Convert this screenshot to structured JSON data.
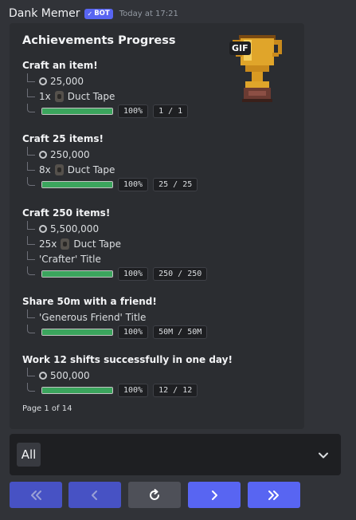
{
  "message": {
    "username": "Dank Memer",
    "bot_badge": "BOT",
    "timestamp": "Today at 17:21"
  },
  "embed": {
    "title": "Achievements Progress",
    "gif_badge": "GIF",
    "footer": "Page 1 of 14",
    "achievements": [
      {
        "title": "Craft an item!",
        "rewards": [
          {
            "icon": "coin-icon",
            "text": "25,000"
          },
          {
            "qty": "1x",
            "icon": "duct-tape-icon",
            "text": "Duct Tape"
          }
        ],
        "progress_fraction": 1.0,
        "percent": "100%",
        "count": "1 / 1"
      },
      {
        "title": "Craft 25 items!",
        "rewards": [
          {
            "icon": "coin-icon",
            "text": "250,000"
          },
          {
            "qty": "8x",
            "icon": "duct-tape-icon",
            "text": "Duct Tape"
          }
        ],
        "progress_fraction": 1.0,
        "percent": "100%",
        "count": "25 / 25"
      },
      {
        "title": "Craft 250 items!",
        "rewards": [
          {
            "icon": "coin-icon",
            "text": "5,500,000"
          },
          {
            "qty": "25x",
            "icon": "duct-tape-icon",
            "text": "Duct Tape"
          },
          {
            "text": "'Crafter' Title"
          }
        ],
        "progress_fraction": 1.0,
        "percent": "100%",
        "count": "250 / 250"
      },
      {
        "title": "Share 50m with a friend!",
        "rewards": [
          {
            "text": "'Generous Friend' Title"
          }
        ],
        "progress_fraction": 1.0,
        "percent": "100%",
        "count": "50M / 50M"
      },
      {
        "title": "Work 12 shifts successfully in one day!",
        "rewards": [
          {
            "icon": "coin-icon",
            "text": "500,000"
          }
        ],
        "progress_fraction": 1.0,
        "percent": "100%",
        "count": "12 / 12"
      }
    ]
  },
  "select_menu": {
    "value": "All",
    "icon": "chevron-down-icon"
  },
  "buttons": [
    {
      "name": "first-page-button",
      "icon": "double-chevron-left-icon",
      "color": "#4752c4"
    },
    {
      "name": "prev-page-button",
      "icon": "chevron-left-icon",
      "color": "#4752c4"
    },
    {
      "name": "refresh-button",
      "icon": "refresh-icon",
      "color": "#4e5058"
    },
    {
      "name": "next-page-button",
      "icon": "chevron-right-icon",
      "color": "#5865f2"
    },
    {
      "name": "last-page-button",
      "icon": "double-chevron-right-icon",
      "color": "#5865f2"
    }
  ],
  "colors": {
    "background": "#313338",
    "embed_bg": "#2b2d31",
    "progress": "#3ba55d",
    "blurple": "#5865f2"
  }
}
